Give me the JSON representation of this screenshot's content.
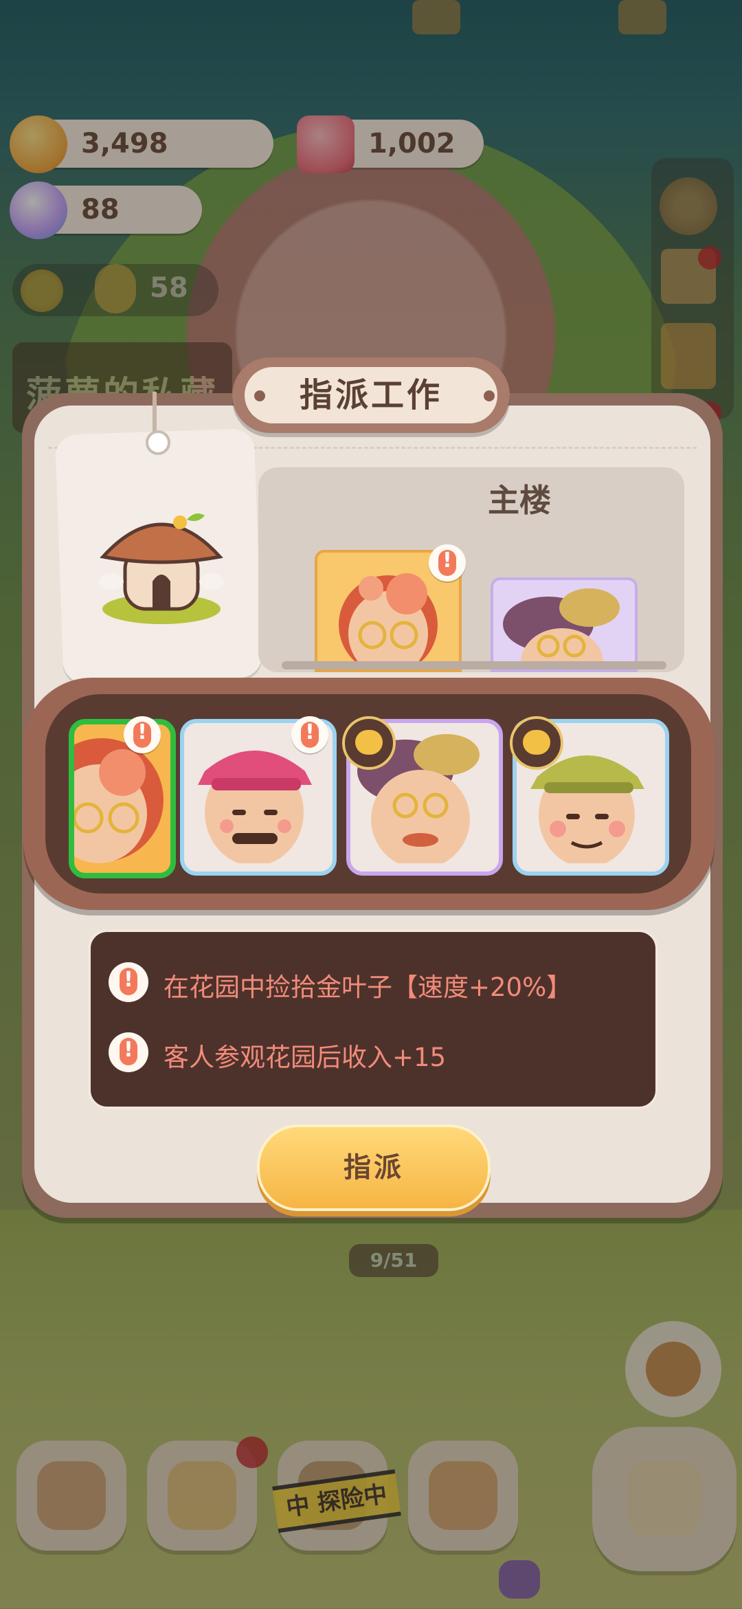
{
  "resources": {
    "coins": "3,498",
    "gems": "1,002",
    "candy": "88",
    "sun_count": "58"
  },
  "background": {
    "sign_text": "菠萝的私藏",
    "progress_chip": "9/51",
    "explore_tape": "中 探险中"
  },
  "dialog": {
    "title": "指派工作",
    "building_name": "主楼",
    "assign_button": "指派",
    "skills": [
      "在花园中捡拾金叶子【速度+20%】",
      "客人参观花园后收入+15"
    ]
  },
  "characters": [
    {
      "name": "grandma-rose",
      "selected": true,
      "has_alert": true
    },
    {
      "name": "pink-cap-man",
      "selected": false,
      "has_alert": true
    },
    {
      "name": "beret-grandpa",
      "selected": false,
      "has_coin": true
    },
    {
      "name": "green-cap-man",
      "selected": false,
      "has_coin": true
    }
  ],
  "colors": {
    "accent": "#f6b544",
    "panel": "#ebe2da",
    "selected_border": "#2fbd3f",
    "skill_text": "#f28b7a"
  }
}
